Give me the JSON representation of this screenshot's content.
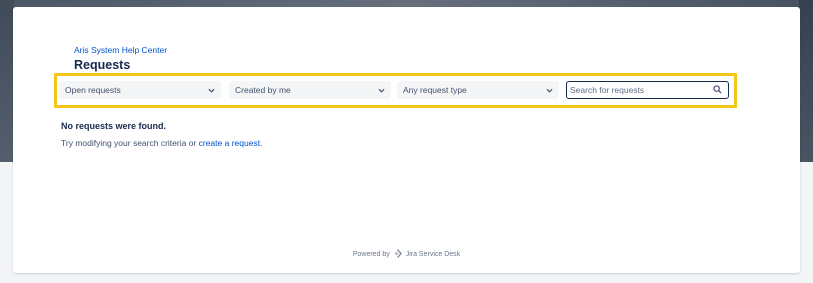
{
  "colors": {
    "link": "#0052cc",
    "heading": "#172b4d",
    "annotation": "#f5c518"
  },
  "portal": {
    "breadcrumb": "Aris System Help Center"
  },
  "page": {
    "title": "Requests"
  },
  "filters": {
    "status": {
      "selected": "Open requests",
      "icon": "chevron-down-icon"
    },
    "creator": {
      "selected": "Created by me",
      "icon": "chevron-down-icon"
    },
    "type": {
      "selected": "Any request type",
      "icon": "chevron-down-icon"
    }
  },
  "search": {
    "placeholder": "Search for requests",
    "value": "",
    "icon": "search-icon"
  },
  "empty_state": {
    "title": "No requests were found.",
    "hint_prefix": "Try modifying your search criteria or ",
    "hint_link": "create a request",
    "hint_suffix": "."
  },
  "footer": {
    "powered_by": "Powered by",
    "product": "Jira Service Desk",
    "icon": "jira-logo-icon"
  },
  "annotation": {
    "icon": "arrow-right-icon"
  }
}
